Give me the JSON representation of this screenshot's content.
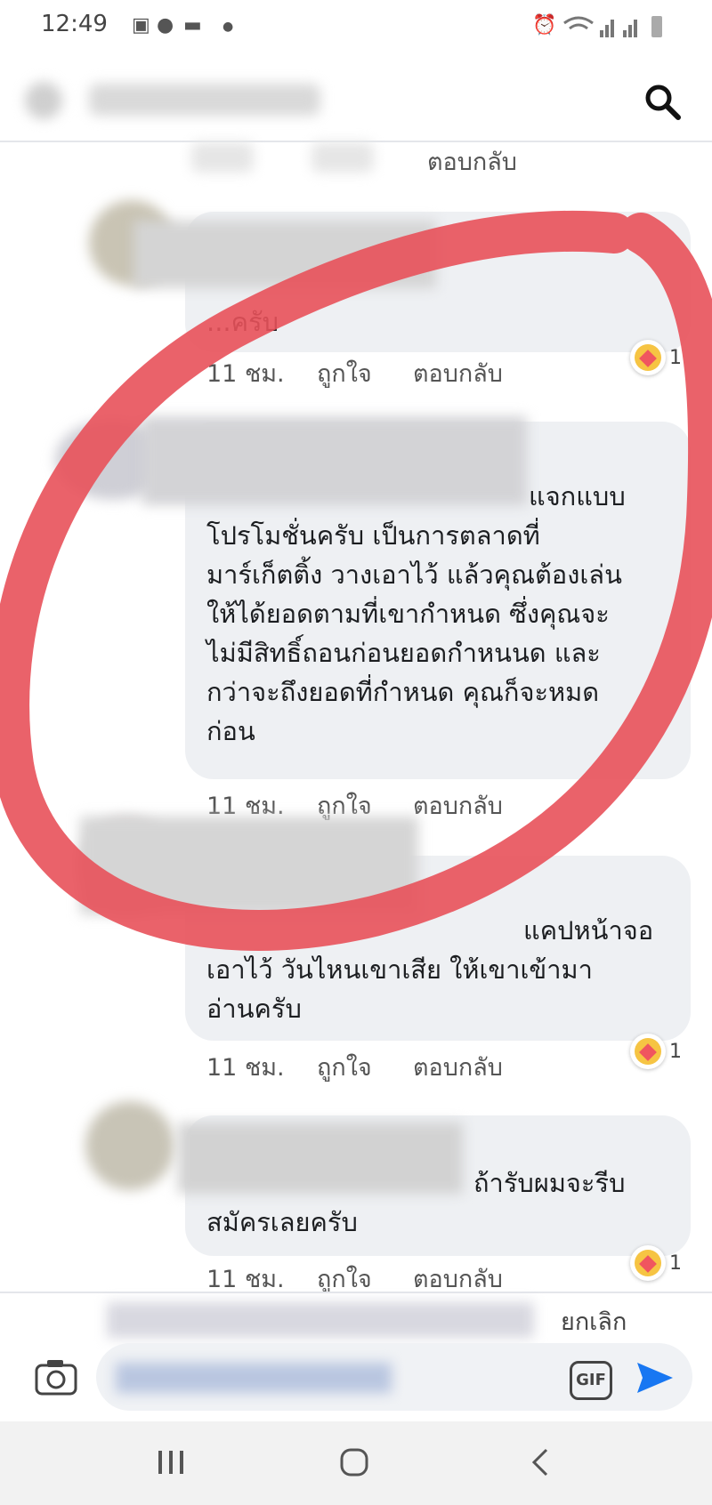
{
  "status_bar": {
    "time": "12:49"
  },
  "comment_actions": {
    "like": "ถูกใจ",
    "reply": "ตอบกลับ"
  },
  "comments": [
    {
      "time": "11 ชม.",
      "text_lines": [
        "...ครับ"
      ],
      "reactions": "1"
    },
    {
      "time": "11 ชม.",
      "text_lines": [
        "แจกแบบ",
        "โปรโมชั่นครับ เป็นการตลาดที่",
        "มาร์เก็ตติ้ง วางเอาไว้ แล้วคุณต้องเล่น",
        "ให้ได้ยอดตามที่เขากำหนด ซึ่งคุณจะ",
        "ไม่มีสิทธิ์ถอนก่อนยอดกำหนนด และ",
        "กว่าจะถึงยอดที่กำหนด คุณก็จะหมด",
        "ก่อน"
      ]
    },
    {
      "time": "11 ชม.",
      "text_lines": [
        "แคปหน้าจอ",
        "เอาไว้ วันไหนเขาเสีย ให้เขาเข้ามา",
        "อ่านครับ"
      ],
      "reactions": "1"
    },
    {
      "time": "11 ชม.",
      "text_lines": [
        "ถ้ารับผมจะรีบ",
        "สมัครเลยครับ"
      ],
      "reactions": "1"
    }
  ],
  "composer": {
    "cancel_label": "ยกเลิก",
    "gif_label": "GIF"
  },
  "colors": {
    "accent": "#1877f2",
    "annotation": "#e8515a",
    "bubble": "#eef0f3"
  }
}
